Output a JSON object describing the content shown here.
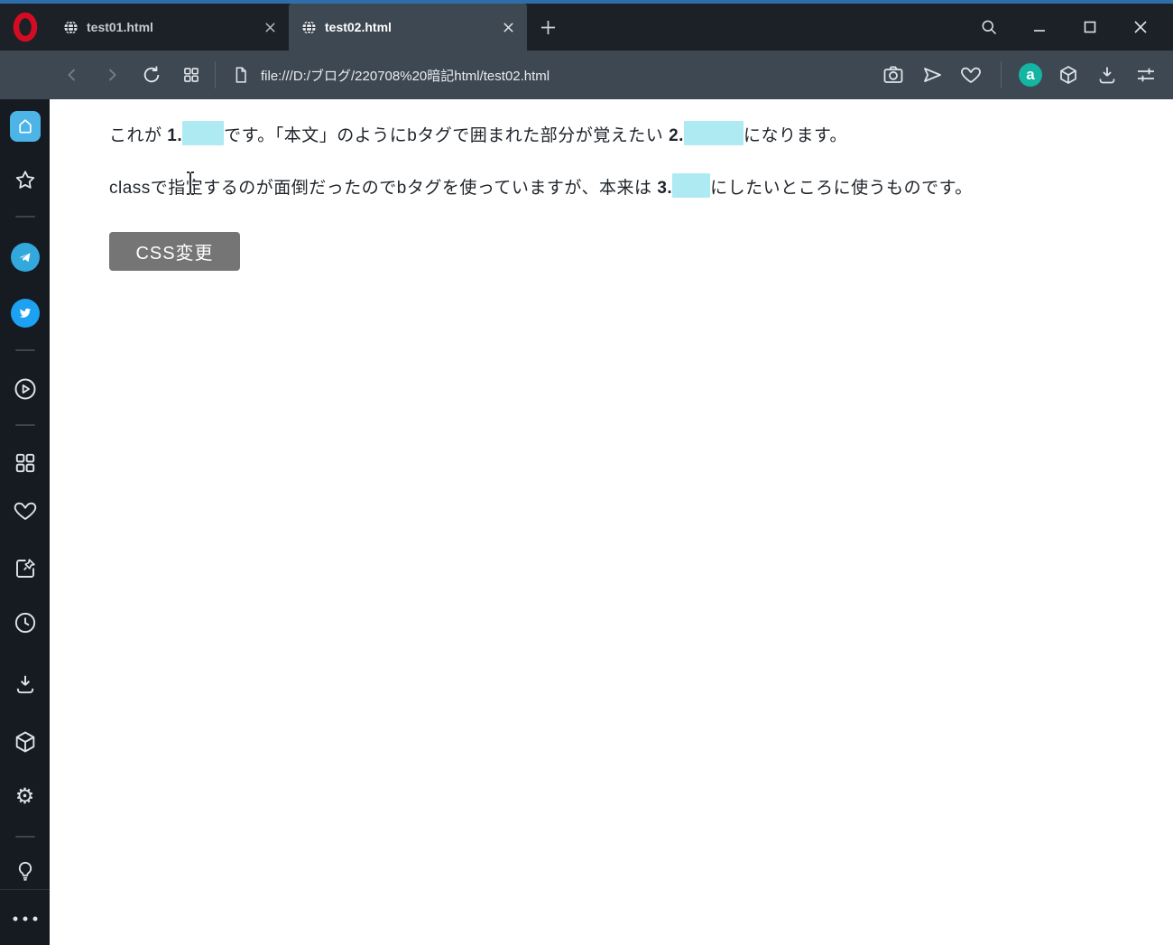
{
  "theme": {
    "accent_stripe": "#2e6fa9",
    "tabbar_bg": "#1b2127",
    "toolbar_bg": "#3e4853",
    "sidebar_bg": "#161b21",
    "highlight_color": "#aeeaf2",
    "button_bg": "#757575",
    "opera_red": "#d40c23",
    "amazon_badge_teal": "#14b5a2"
  },
  "tabbar": {
    "tabs": [
      {
        "label": "test01.html",
        "active": false
      },
      {
        "label": "test02.html",
        "active": true
      }
    ]
  },
  "window_controls": [
    "search-icon",
    "minimize-icon",
    "maximize-icon",
    "close-icon"
  ],
  "toolbar": {
    "url": "file:///D:/ブログ/220708%20暗記html/test02.html",
    "left_icons": [
      "back-icon",
      "forward-icon",
      "reload-icon",
      "tab-grid-icon",
      "page-icon"
    ],
    "right_icons": [
      "camera-icon",
      "send-flow-icon",
      "heart-icon",
      "amazon-badge",
      "cube-icon",
      "download-icon",
      "easy-setup-sliders-icon"
    ]
  },
  "badges": {
    "amazon_letter": "a"
  },
  "icons": {
    "gear_glyph": "⚙"
  },
  "sidebar_icons": [
    "home-icon",
    "bookmarks-star-icon",
    "telegram-icon",
    "twitter-icon",
    "player-icon",
    "speed-dial-grid-icon",
    "personal-news-heart-icon",
    "pinboards-icon",
    "history-clock-icon",
    "downloads-icon",
    "extensions-cube-icon",
    "settings-gear-icon",
    "lightbulb-icon",
    "more-dots-icon"
  ],
  "content": {
    "p1": {
      "t1": "これが ",
      "n1": "1.",
      "t2": "です。「本文」のようにbタグで囲まれた部分が覚えたい ",
      "n2": "2.",
      "t3": "になります。"
    },
    "p2": {
      "t1": "classで指定するのが面倒だったのでbタグを使っていますが、本来は ",
      "n1": "3.",
      "t2": "にしたいところに使うものです。"
    },
    "button_label": "CSS変更"
  }
}
